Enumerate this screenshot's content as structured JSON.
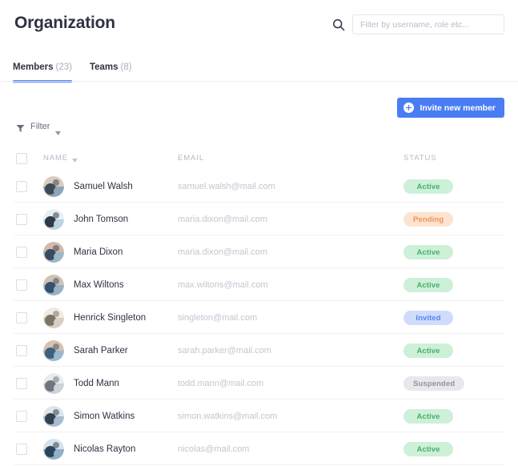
{
  "header": {
    "title": "Organization",
    "search": {
      "icon": "search-icon",
      "placeholder": "Filter by username, role etc...",
      "value": ""
    }
  },
  "tabs": [
    {
      "label": "Members",
      "count": "(23)",
      "active": true
    },
    {
      "label": "Teams",
      "count": "(8)",
      "active": false
    }
  ],
  "toolbar": {
    "invite_label": "Invite new member",
    "invite_icon": "plus-circle-icon",
    "filter_label": "Filter",
    "filter_icon": "funnel-icon",
    "filter_caret": "chevron-down-icon"
  },
  "table": {
    "columns": [
      {
        "key": "name",
        "label": "NAME",
        "sortable": true
      },
      {
        "key": "email",
        "label": "EMAIL",
        "sortable": false
      },
      {
        "key": "status",
        "label": "STATUS",
        "sortable": false
      }
    ],
    "rows": [
      {
        "name": "Samuel Walsh",
        "email": "samuel.walsh@mail.com",
        "status": "Active",
        "status_key": "active"
      },
      {
        "name": "John Tomson",
        "email": "maria.dixon@mail.com",
        "status": "Pending",
        "status_key": "pending"
      },
      {
        "name": "Maria Dixon",
        "email": "maria.dixon@mail.com",
        "status": "Active",
        "status_key": "active"
      },
      {
        "name": "Max Wiltons",
        "email": "max.wiltons@mail.com",
        "status": "Active",
        "status_key": "active"
      },
      {
        "name": "Henrick Singleton",
        "email": "singleton@mail.com",
        "status": "Invited",
        "status_key": "invited"
      },
      {
        "name": "Sarah Parker",
        "email": "sarah.parker@mail.com",
        "status": "Active",
        "status_key": "active"
      },
      {
        "name": "Todd Mann",
        "email": "todd.mann@mail.com",
        "status": "Suspended",
        "status_key": "suspended"
      },
      {
        "name": "Simon Watkins",
        "email": "simon.watkins@mail.com",
        "status": "Active",
        "status_key": "active"
      },
      {
        "name": "Nicolas Rayton",
        "email": "nicolas@mail.com",
        "status": "Active",
        "status_key": "active"
      }
    ]
  },
  "colors": {
    "accent": "#4a7df4",
    "title": "#2e3243",
    "muted": "#b6bac6",
    "email": "#c3c6d0",
    "status_active_bg": "#cdf0d8",
    "status_active_fg": "#46b06b",
    "status_pending_bg": "#fde3d0",
    "status_pending_fg": "#ef9356",
    "status_invited_bg": "#cfdcfb",
    "status_invited_fg": "#5b85f0",
    "status_suspended_bg": "#e7e8eb",
    "status_suspended_fg": "#8f94a3"
  },
  "avatars": [
    {
      "a": "#8ea4b8",
      "b": "#3d4a57",
      "c": "#d8cdbf"
    },
    {
      "a": "#bcd3e2",
      "b": "#2f3a46",
      "c": "#e8eef3"
    },
    {
      "a": "#9fb6c6",
      "b": "#3a4b5e",
      "c": "#d3b9a8"
    },
    {
      "a": "#97b0c4",
      "b": "#36506e",
      "c": "#cfc3b2"
    },
    {
      "a": "#d7cfc4",
      "b": "#7d7468",
      "c": "#efe9e1"
    },
    {
      "a": "#9bb7cd",
      "b": "#3f5f7d",
      "c": "#dac0ad"
    },
    {
      "a": "#cfd2d6",
      "b": "#6f7681",
      "c": "#e9ebee"
    },
    {
      "a": "#a8bccd",
      "b": "#33424f",
      "c": "#dde4ea"
    },
    {
      "a": "#8fb0c8",
      "b": "#2d4357",
      "c": "#d6e1e9"
    }
  ]
}
